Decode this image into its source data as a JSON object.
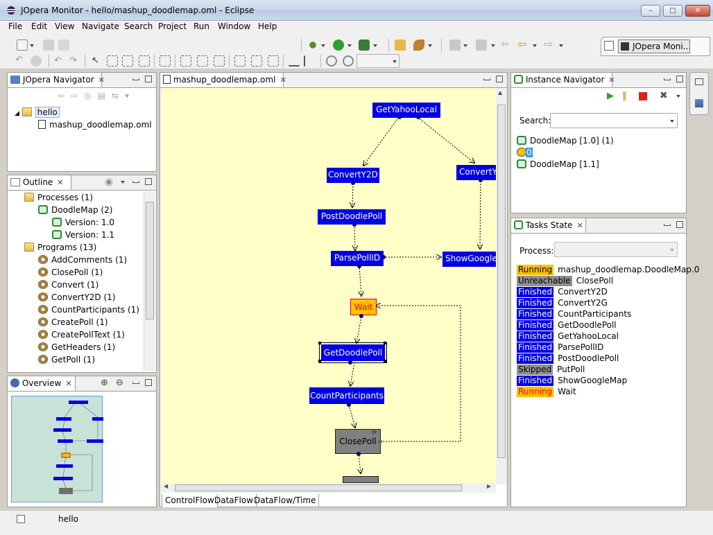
{
  "window": {
    "title": "JOpera Monitor - hello/mashup_doodlemap.oml - Eclipse",
    "min": "–",
    "max": "□",
    "close": "✕"
  },
  "menu": [
    "File",
    "Edit",
    "View",
    "Navigate",
    "Search",
    "Project",
    "Run",
    "Window",
    "Help"
  ],
  "perspective": {
    "label": "JOpera Moni..."
  },
  "navigator": {
    "tab": "JOpera Navigator",
    "items": [
      {
        "label": "hello"
      },
      {
        "label": "mashup_doodlemap.oml"
      }
    ]
  },
  "outline": {
    "tab": "Outline",
    "items": [
      {
        "label": "Processes (1)",
        "icon": "folder-icon"
      },
      {
        "label": "DoodleMap (2)",
        "icon": "process-icon"
      },
      {
        "label": "Version: 1.0",
        "icon": "process-icon"
      },
      {
        "label": "Version: 1.1",
        "icon": "process-icon"
      },
      {
        "label": "Programs (13)",
        "icon": "folder-icon"
      },
      {
        "label": "AddComments (1)",
        "icon": "gear-icon"
      },
      {
        "label": "ClosePoll (1)",
        "icon": "gear-icon"
      },
      {
        "label": "Convert (1)",
        "icon": "gear-icon"
      },
      {
        "label": "ConvertY2D (1)",
        "icon": "gear-icon"
      },
      {
        "label": "CountParticipants (1)",
        "icon": "gear-icon"
      },
      {
        "label": "CreatePoll (1)",
        "icon": "gear-icon"
      },
      {
        "label": "CreatePollText (1)",
        "icon": "gear-icon"
      },
      {
        "label": "GetHeaders (1)",
        "icon": "gear-icon"
      },
      {
        "label": "GetPoll (1)",
        "icon": "gear-icon"
      }
    ]
  },
  "overview": {
    "tab": "Overview"
  },
  "editor": {
    "tab": "mashup_doodlemap.oml",
    "nodes": [
      {
        "label": "GetYahooLocal"
      },
      {
        "label": "ConvertY2D"
      },
      {
        "label": "ConvertY"
      },
      {
        "label": "PostDoodlePoll"
      },
      {
        "label": "ParsePollID"
      },
      {
        "label": "ShowGoogle"
      },
      {
        "label": "Wait"
      },
      {
        "label": "GetDoodlePoll"
      },
      {
        "label": "CountParticipants"
      },
      {
        "label": "ClosePoll"
      }
    ],
    "bottom_tabs": [
      "ControlFlow",
      "DataFlow",
      "DataFlow/Time"
    ]
  },
  "instance_navigator": {
    "tab": "Instance Navigator",
    "search_label": "Search:",
    "search_value": "",
    "items": [
      {
        "label": "DoodleMap [1.0] (1)"
      },
      {
        "label": "0"
      },
      {
        "label": "DoodleMap [1.1]"
      }
    ]
  },
  "tasks_state": {
    "tab": "Tasks State",
    "process_label": "Process:",
    "rows": [
      {
        "state": "Running",
        "task": "mashup_doodlemap.DoodleMap.0",
        "color": "#ffc000",
        "text": "#000000"
      },
      {
        "state": "Unreachable",
        "task": "ClosePoll",
        "color": "#909090",
        "text": "#000000"
      },
      {
        "state": "Finished",
        "task": "ConvertY2D",
        "color": "#0000e6",
        "text": "#ffffff"
      },
      {
        "state": "Finished",
        "task": "ConvertY2G",
        "color": "#0000e6",
        "text": "#ffffff"
      },
      {
        "state": "Finished",
        "task": "CountParticipants",
        "color": "#0000e6",
        "text": "#ffffff"
      },
      {
        "state": "Finished",
        "task": "GetDoodlePoll",
        "color": "#0000e6",
        "text": "#ffffff"
      },
      {
        "state": "Finished",
        "task": "GetYahooLocal",
        "color": "#0000e6",
        "text": "#ffffff"
      },
      {
        "state": "Finished",
        "task": "ParsePollID",
        "color": "#0000e6",
        "text": "#ffffff"
      },
      {
        "state": "Finished",
        "task": "PostDoodlePoll",
        "color": "#0000e6",
        "text": "#ffffff"
      },
      {
        "state": "Skipped",
        "task": "PutPoll",
        "color": "#909090",
        "text": "#000000"
      },
      {
        "state": "Finished",
        "task": "ShowGoogleMap",
        "color": "#0000e6",
        "text": "#ffffff"
      },
      {
        "state": "Running",
        "task": "Wait",
        "color": "#ffc000",
        "text": "#ff0000"
      }
    ]
  },
  "statusbar": {
    "text": "hello"
  }
}
